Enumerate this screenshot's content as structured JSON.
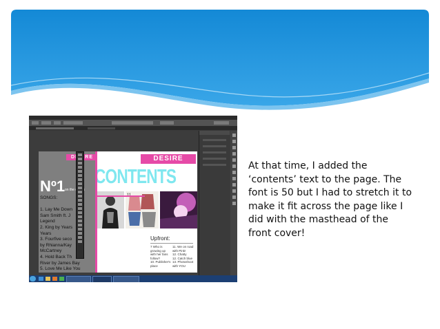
{
  "slide": {
    "caption": "At that time, I added the ‘contents’ text to the page. The font is 50 but I had to stretch it to make it fit across the page like I did with the masthead of the front cover!"
  },
  "colors": {
    "banner_blue": "#1b8fd8",
    "magazine_pink": "#e64aa7",
    "contents_cyan": "#7fe7ef"
  },
  "screenshot": {
    "app": "photoshop-window",
    "left_page": {
      "masthead": "DESIRE",
      "number_one": "Nº1",
      "on_the_charts": "on the charts",
      "songs": "SONGS:\n\n1. Lay Me Down\nSam Smith ft. J\nLegend\n2. King by Years\nYears\n3. Fourfive seco\nby Rhianna/Kay\nMcCartney\n4. Hold Back Th\nRiver by James Bay\n5. Love Me Like You"
    },
    "right_page": {
      "masthead": "DESIRE",
      "heading": "CONTENTS",
      "photo_number": "11",
      "upfront": "Upfront:",
      "col1": "7 Who is\ngrowing up\nwith her fans\nfollow?\n10. Publisher's\nplace",
      "col2": "11. We on road\nwith Pink!\n12. Chatty\n12. Catch blue\n13. Photoshoot\nwith YOU"
    },
    "taskbar_icons": [
      "start-orb-icon",
      "ie-icon",
      "folder-icon",
      "media-icon",
      "chrome-icon",
      "photoshop-icon",
      "word-icon"
    ]
  }
}
